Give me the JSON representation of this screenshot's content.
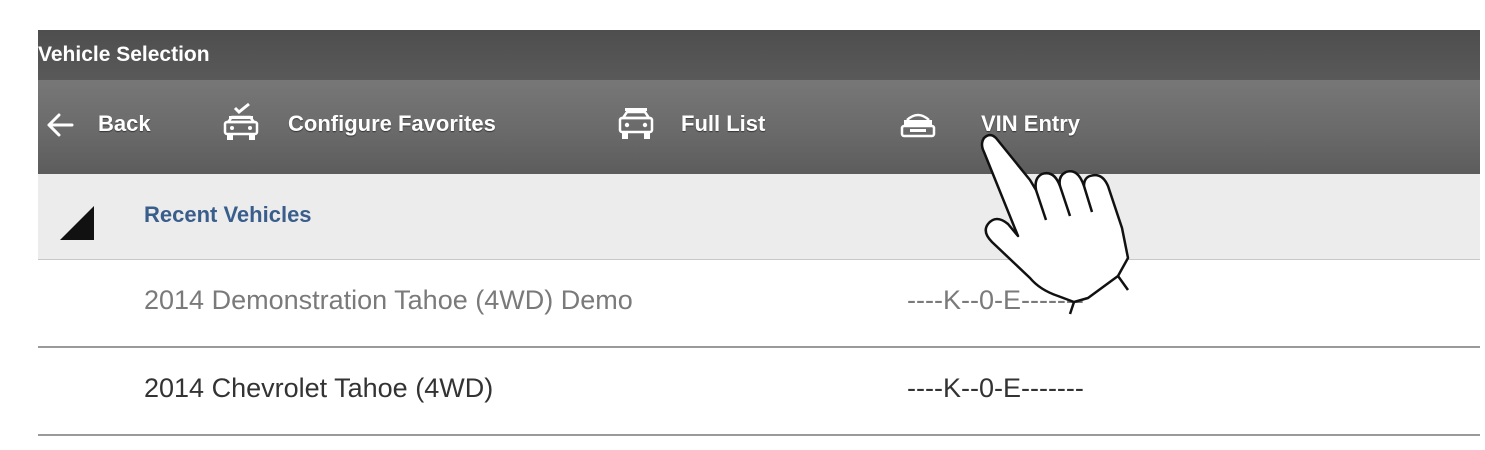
{
  "window": {
    "title": "Vehicle Selection"
  },
  "toolbar": {
    "back_label": "Back",
    "configure_favorites_label": "Configure Favorites",
    "full_list_label": "Full List",
    "vin_entry_label": "VIN Entry"
  },
  "recent": {
    "header": "Recent Vehicles",
    "rows": [
      {
        "name": "2014 Demonstration Tahoe (4WD) Demo",
        "vin": "----K--0-E-------"
      },
      {
        "name": "2014 Chevrolet Tahoe (4WD)",
        "vin": "----K--0-E-------"
      }
    ]
  },
  "icons": {
    "back": "back-arrow-icon",
    "configure_favorites": "car-checkmark-icon",
    "full_list": "car-front-icon",
    "vin_entry": "vin-scanner-icon",
    "collapse": "collapse-triangle-icon",
    "pointer": "tap-hand-icon"
  },
  "colors": {
    "title_bar": "#535353",
    "toolbar": "#6a6a6a",
    "section_label": "#3a5e8c",
    "section_bg": "#ececec",
    "demo_text": "#7a7a7a",
    "row_text": "#333333"
  }
}
